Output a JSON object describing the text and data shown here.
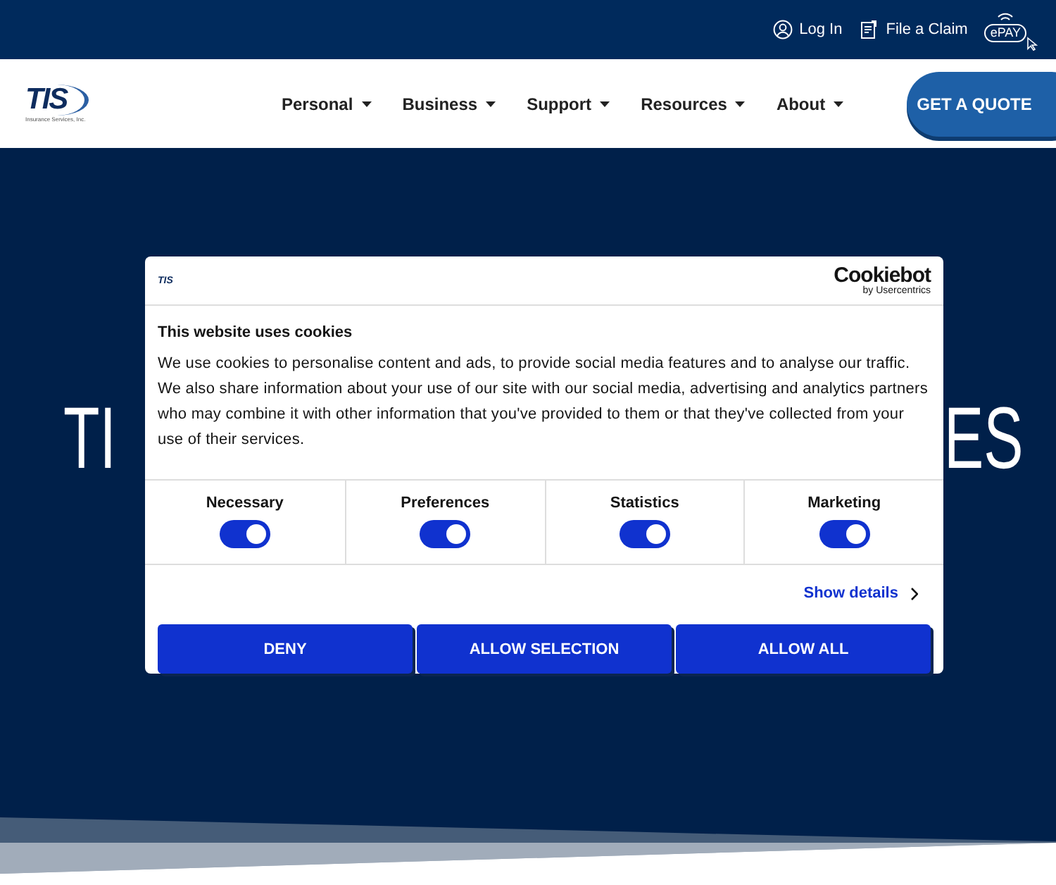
{
  "top_bar": {
    "links": [
      {
        "kind": "user",
        "label": "Log In"
      },
      {
        "kind": "claim",
        "label": "File a Claim"
      },
      {
        "kind": "epay",
        "label": "ePAY"
      }
    ]
  },
  "header": {
    "logo": {
      "text": "TIS",
      "tagline": "Insurance Services, Inc."
    },
    "nav": [
      {
        "label": "Personal"
      },
      {
        "label": "Business"
      },
      {
        "label": "Support"
      },
      {
        "label": "Resources"
      },
      {
        "label": "About"
      }
    ],
    "cta": "GET A QUOTE"
  },
  "hero": {
    "title_left": "TI",
    "title_right": "ES"
  },
  "cookie_dialog": {
    "logo": "TIS",
    "provider": "Cookiebot",
    "provider_tagline": "by Usercentrics",
    "title": "This website uses cookies",
    "text": "We use cookies to personalise content and ads, to provide social media features and to analyse our traffic. We also share information about your use of our site with our social media, advertising and analytics partners who may combine it with other information that you've provided to them or that they've collected from your use of their services.",
    "categories": [
      {
        "label": "Necessary",
        "checked": true
      },
      {
        "label": "Preferences",
        "checked": true
      },
      {
        "label": "Statistics",
        "checked": true
      },
      {
        "label": "Marketing",
        "checked": true
      }
    ],
    "details_link": "Show details",
    "buttons": [
      "DENY",
      "ALLOW SELECTION",
      "ALLOW ALL"
    ]
  }
}
